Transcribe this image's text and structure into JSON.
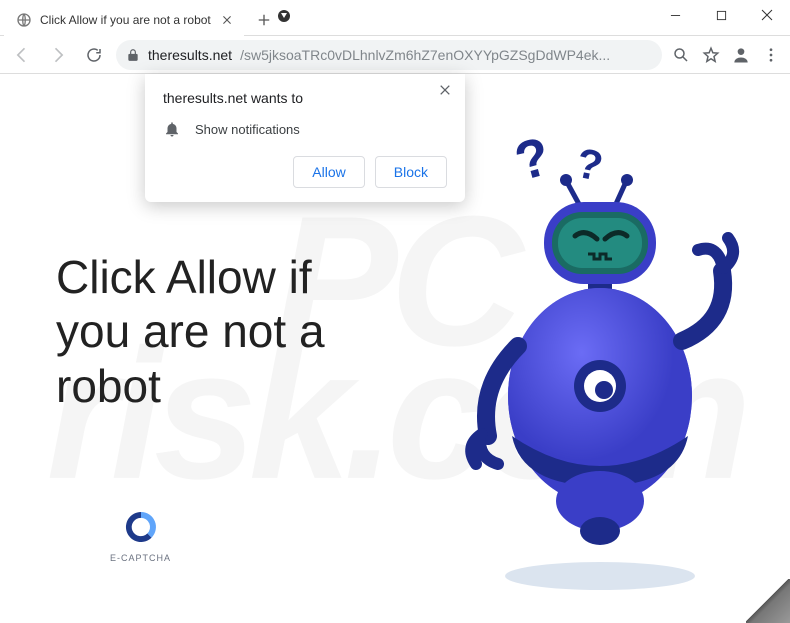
{
  "window": {
    "tab_title": "Click Allow if you are not a robot"
  },
  "addressbar": {
    "host": "theresults.net",
    "path": "/sw5jksoaTRc0vDLhnlvZm6hZ7enOXYYpGZSgDdWP4ek..."
  },
  "prompt": {
    "origin": "theresults.net wants to",
    "permission": "Show notifications",
    "allow": "Allow",
    "block": "Block"
  },
  "page": {
    "headline_l1": "Click Allow if",
    "headline_l2": "you are not a",
    "headline_l3": "robot",
    "badge": "E-CAPTCHA"
  },
  "watermark": {
    "l1": "PC",
    "l2": "risk.com"
  }
}
